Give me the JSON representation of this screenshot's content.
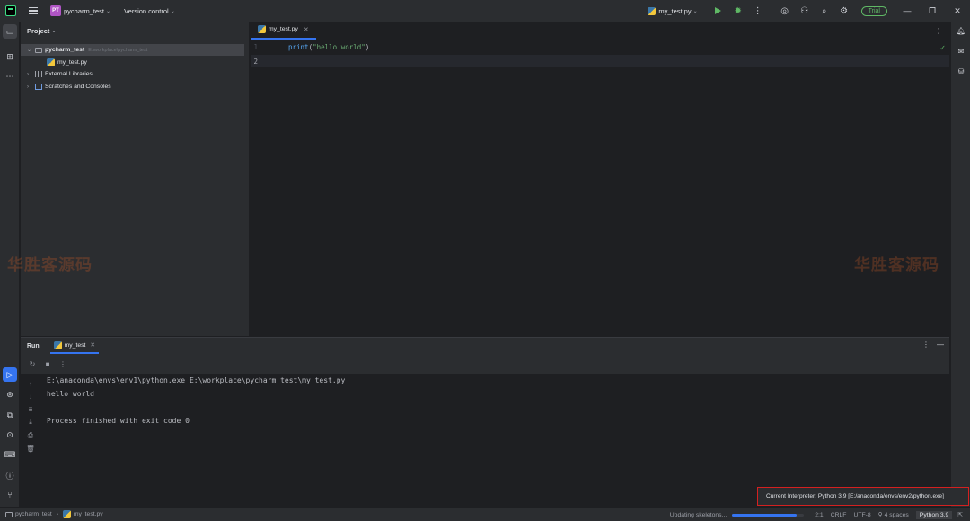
{
  "titlebar": {
    "project_badge": "PT",
    "project_name": "pycharm_test",
    "version_control": "Version control",
    "run_config": "my_test.py",
    "trial_label": "Trial"
  },
  "project_panel": {
    "title": "Project",
    "tree": [
      {
        "label": "pycharm_test",
        "path": "E:\\workplace\\pycharm_test"
      },
      {
        "label": "my_test.py"
      },
      {
        "label": "External Libraries"
      },
      {
        "label": "Scratches and Consoles"
      }
    ]
  },
  "editor": {
    "tab_label": "my_test.py",
    "line_numbers": [
      "1",
      "2"
    ],
    "code": {
      "fn": "print",
      "open": "(",
      "str": "\"hello world\"",
      "close": ")"
    }
  },
  "watermark": "华胜客源码",
  "run_panel": {
    "title": "Run",
    "tab_label": "my_test",
    "console_lines": [
      "E:\\anaconda\\envs\\env1\\python.exe E:\\workplace\\pycharm_test\\my_test.py",
      "hello world",
      "",
      "Process finished with exit code 0"
    ]
  },
  "statusbar": {
    "breadcrumb": [
      "pycharm_test",
      "my_test.py"
    ],
    "task": "Updating skeletons...",
    "progress_fraction": 0.9,
    "position": "2:1",
    "line_sep": "CRLF",
    "encoding": "UTF-8",
    "indent": "4 spaces",
    "interpreter": "Python 3.9"
  },
  "tooltip": "Current Interpreter: Python 3.9 [E:/anaconda/envs/env2/python.exe]",
  "colors": {
    "accent": "#3574f0",
    "run_green": "#5fb865",
    "highlight_border": "#d42020"
  }
}
